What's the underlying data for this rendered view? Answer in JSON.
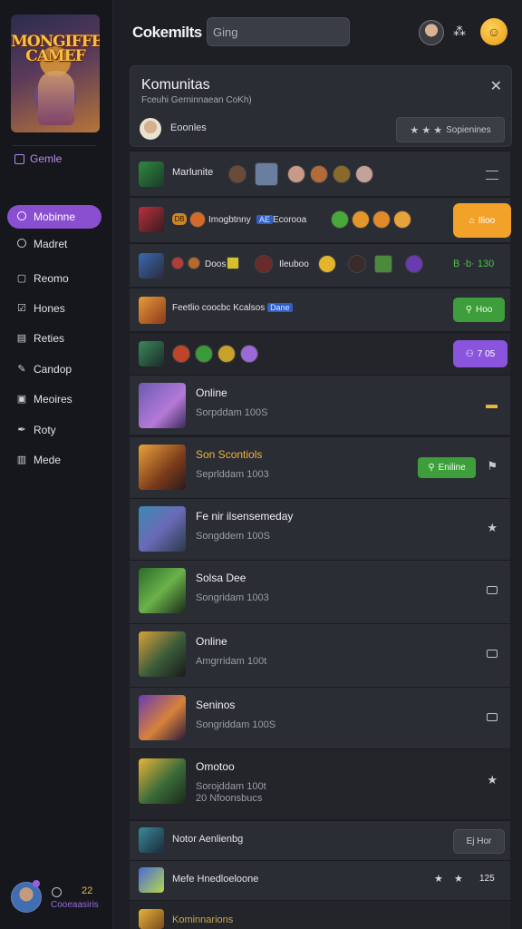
{
  "sidebar": {
    "logo_text_1": "MONGIFFE",
    "logo_text_2": "CAMEF",
    "game_label": "Gemle",
    "nav": [
      {
        "label": "Mobinne",
        "icon": "ring-icon",
        "active": true
      },
      {
        "label": "Madret",
        "icon": "ring-icon"
      },
      {
        "label": "Reomo",
        "icon": "square-icon"
      },
      {
        "label": "Hones",
        "icon": "check-icon"
      },
      {
        "label": "Reties",
        "icon": "edit-icon"
      },
      {
        "label": "Candop",
        "icon": "pencil-icon"
      },
      {
        "label": "Meoires",
        "icon": "monitor-icon"
      },
      {
        "label": "Roty",
        "icon": "quill-icon"
      },
      {
        "label": "Mede",
        "icon": "box-icon"
      }
    ],
    "footer_number": "22",
    "footer_label": "Cooeaasiris"
  },
  "topbar": {
    "title": "Cokemilts",
    "search_placeholder": "Ging"
  },
  "panel": {
    "title": "Komunitas",
    "subtitle": "Fceuhi Gerninnaean CoKh)",
    "user_name": "Eoonles",
    "action_label": "Sopienines"
  },
  "rows": {
    "r1": {
      "label": "Marlunite"
    },
    "r2": {
      "label_a": "Imogbtnny",
      "label_b": "Ecorooa",
      "badge_left": "DB",
      "tag": "AE",
      "button": "Ilioo"
    },
    "r3": {
      "label_a": "Doos",
      "label_b": "Ileuboo",
      "right_text": "B ·b· 130"
    },
    "r4": {
      "label": "Feetlio coocbc Kcalsos",
      "tag": "Dane",
      "button": "Hoo"
    },
    "r5": {
      "button": "7 05"
    }
  },
  "games": [
    {
      "title": "Online",
      "sub": "Sorpddam 100S"
    },
    {
      "title": "Son Scontiols",
      "sub": "Seprlddam 1003",
      "button": "Eniline"
    },
    {
      "title": "Fe nir ilsensemeday",
      "sub": "Songddem 100S"
    },
    {
      "title": "Solsa Dee",
      "sub": "Songridam 1003"
    },
    {
      "title": "Online",
      "sub": "Amgrridam 100t"
    },
    {
      "title": "Seninos",
      "sub": "Songriddam 100S"
    },
    {
      "title": "Omotoo",
      "sub": "Sorojddam 100t",
      "sub2": "20 Nfoonsbucs"
    }
  ],
  "bottom": {
    "row1_label": "Notor Aenlienbg",
    "row1_button": "Ej Hor",
    "row2_label": "Mefe Hnedloeloone",
    "row2_num": "125",
    "row3_label": "Kominnarions"
  },
  "colors": {
    "accent_purple": "#8a4fd0",
    "orange": "#f3a229",
    "green": "#3e9e3b"
  }
}
